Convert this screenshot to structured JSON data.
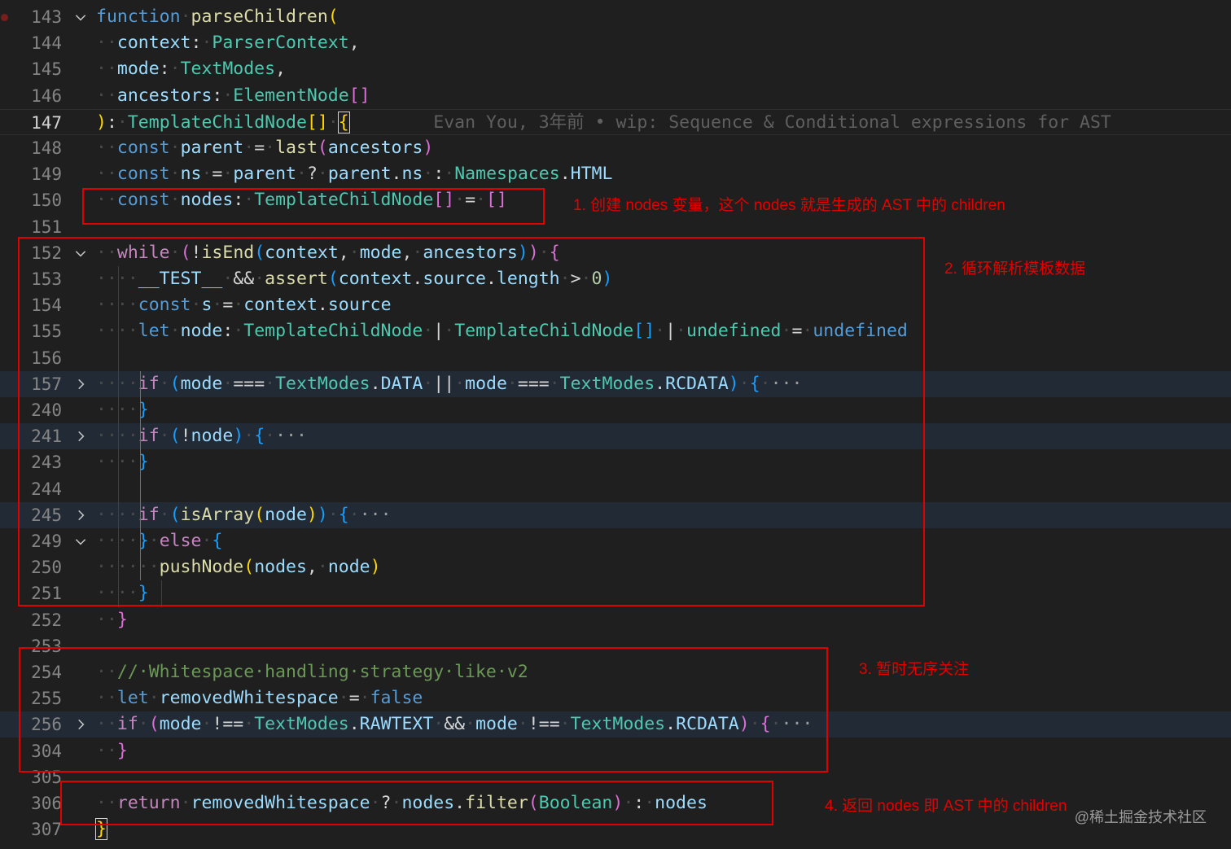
{
  "editor": {
    "breakpoint_line": "143",
    "active_line": "147",
    "lines": [
      {
        "num": "143",
        "fold": "down",
        "tokens": [
          [
            "kw",
            "function"
          ],
          [
            "ws",
            "·"
          ],
          [
            "fn",
            "parseChildren"
          ],
          [
            "br1",
            "("
          ]
        ]
      },
      {
        "num": "144",
        "tokens": [
          [
            "ws",
            "··"
          ],
          [
            "vr",
            "context"
          ],
          [
            "pl",
            ":"
          ],
          [
            "ws",
            "·"
          ],
          [
            "ty",
            "ParserContext"
          ],
          [
            "pl",
            ","
          ]
        ]
      },
      {
        "num": "145",
        "tokens": [
          [
            "ws",
            "··"
          ],
          [
            "vr",
            "mode"
          ],
          [
            "pl",
            ":"
          ],
          [
            "ws",
            "·"
          ],
          [
            "ty",
            "TextModes"
          ],
          [
            "pl",
            ","
          ]
        ]
      },
      {
        "num": "146",
        "tokens": [
          [
            "ws",
            "··"
          ],
          [
            "vr",
            "ancestors"
          ],
          [
            "pl",
            ":"
          ],
          [
            "ws",
            "·"
          ],
          [
            "ty",
            "ElementNode"
          ],
          [
            "br2",
            "[]"
          ]
        ]
      },
      {
        "num": "147",
        "tokens": [
          [
            "br1",
            ")"
          ],
          [
            "pl",
            ":"
          ],
          [
            "ws",
            "·"
          ],
          [
            "ty",
            "TemplateChildNode"
          ],
          [
            "br1",
            "[]"
          ],
          [
            "ws",
            "·"
          ],
          [
            "br1cursor",
            "{"
          ],
          [
            "blame",
            "        Evan You, 3年前 • wip: Sequence & Conditional expressions for AST"
          ]
        ]
      },
      {
        "num": "148",
        "tokens": [
          [
            "ws",
            "··"
          ],
          [
            "kw",
            "const"
          ],
          [
            "ws",
            "·"
          ],
          [
            "vr",
            "parent"
          ],
          [
            "ws",
            "·"
          ],
          [
            "pl",
            "="
          ],
          [
            "ws",
            "·"
          ],
          [
            "fn",
            "last"
          ],
          [
            "br2",
            "("
          ],
          [
            "vr",
            "ancestors"
          ],
          [
            "br2",
            ")"
          ]
        ]
      },
      {
        "num": "149",
        "tokens": [
          [
            "ws",
            "··"
          ],
          [
            "kw",
            "const"
          ],
          [
            "ws",
            "·"
          ],
          [
            "vr",
            "ns"
          ],
          [
            "ws",
            "·"
          ],
          [
            "pl",
            "="
          ],
          [
            "ws",
            "·"
          ],
          [
            "vr",
            "parent"
          ],
          [
            "ws",
            "·"
          ],
          [
            "pl",
            "?"
          ],
          [
            "ws",
            "·"
          ],
          [
            "vr",
            "parent"
          ],
          [
            "pl",
            "."
          ],
          [
            "vr",
            "ns"
          ],
          [
            "ws",
            "·"
          ],
          [
            "pl",
            ":"
          ],
          [
            "ws",
            "·"
          ],
          [
            "ty",
            "Namespaces"
          ],
          [
            "pl",
            "."
          ],
          [
            "vr",
            "HTML"
          ]
        ]
      },
      {
        "num": "150",
        "tokens": [
          [
            "ws",
            "··"
          ],
          [
            "kw",
            "const"
          ],
          [
            "ws",
            "·"
          ],
          [
            "vr",
            "nodes"
          ],
          [
            "pl",
            ":"
          ],
          [
            "ws",
            "·"
          ],
          [
            "ty",
            "TemplateChildNode"
          ],
          [
            "br2",
            "[]"
          ],
          [
            "ws",
            "·"
          ],
          [
            "pl",
            "="
          ],
          [
            "ws",
            "·"
          ],
          [
            "br2",
            "[]"
          ]
        ]
      },
      {
        "num": "151",
        "tokens": []
      },
      {
        "num": "152",
        "fold": "down",
        "tokens": [
          [
            "ws",
            "··"
          ],
          [
            "ctl",
            "while"
          ],
          [
            "ws",
            "·"
          ],
          [
            "br2",
            "("
          ],
          [
            "pl",
            "!"
          ],
          [
            "fn",
            "isEnd"
          ],
          [
            "br3",
            "("
          ],
          [
            "vr",
            "context"
          ],
          [
            "pl",
            ","
          ],
          [
            "ws",
            "·"
          ],
          [
            "vr",
            "mode"
          ],
          [
            "pl",
            ","
          ],
          [
            "ws",
            "·"
          ],
          [
            "vr",
            "ancestors"
          ],
          [
            "br3",
            ")"
          ],
          [
            "br2",
            ")"
          ],
          [
            "ws",
            "·"
          ],
          [
            "br2",
            "{"
          ]
        ]
      },
      {
        "num": "153",
        "tokens": [
          [
            "ws",
            "····"
          ],
          [
            "vr",
            "__TEST__"
          ],
          [
            "ws",
            "·"
          ],
          [
            "pl",
            "&&"
          ],
          [
            "ws",
            "·"
          ],
          [
            "fn",
            "assert"
          ],
          [
            "br3",
            "("
          ],
          [
            "vr",
            "context"
          ],
          [
            "pl",
            "."
          ],
          [
            "vr",
            "source"
          ],
          [
            "pl",
            "."
          ],
          [
            "vr",
            "length"
          ],
          [
            "ws",
            "·"
          ],
          [
            "pl",
            ">"
          ],
          [
            "ws",
            "·"
          ],
          [
            "nm",
            "0"
          ],
          [
            "br3",
            ")"
          ]
        ]
      },
      {
        "num": "154",
        "tokens": [
          [
            "ws",
            "····"
          ],
          [
            "kw",
            "const"
          ],
          [
            "ws",
            "·"
          ],
          [
            "vr",
            "s"
          ],
          [
            "ws",
            "·"
          ],
          [
            "pl",
            "="
          ],
          [
            "ws",
            "·"
          ],
          [
            "vr",
            "context"
          ],
          [
            "pl",
            "."
          ],
          [
            "vr",
            "source"
          ]
        ]
      },
      {
        "num": "155",
        "tokens": [
          [
            "ws",
            "····"
          ],
          [
            "kw",
            "let"
          ],
          [
            "ws",
            "·"
          ],
          [
            "vr",
            "node"
          ],
          [
            "pl",
            ":"
          ],
          [
            "ws",
            "·"
          ],
          [
            "ty",
            "TemplateChildNode"
          ],
          [
            "ws",
            "·"
          ],
          [
            "pl",
            "|"
          ],
          [
            "ws",
            "·"
          ],
          [
            "ty",
            "TemplateChildNode"
          ],
          [
            "br3",
            "[]"
          ],
          [
            "ws",
            "·"
          ],
          [
            "pl",
            "|"
          ],
          [
            "ws",
            "·"
          ],
          [
            "ty",
            "undefined"
          ],
          [
            "ws",
            "·"
          ],
          [
            "pl",
            "="
          ],
          [
            "ws",
            "·"
          ],
          [
            "kw",
            "undefined"
          ]
        ]
      },
      {
        "num": "156",
        "tokens": []
      },
      {
        "num": "157",
        "fold": "right",
        "hl": true,
        "tokens": [
          [
            "ws",
            "····"
          ],
          [
            "ctl",
            "if"
          ],
          [
            "ws",
            "·"
          ],
          [
            "br3",
            "("
          ],
          [
            "vr",
            "mode"
          ],
          [
            "ws",
            "·"
          ],
          [
            "pl",
            "==="
          ],
          [
            "ws",
            "·"
          ],
          [
            "ty",
            "TextModes"
          ],
          [
            "pl",
            "."
          ],
          [
            "vr",
            "DATA"
          ],
          [
            "ws",
            "·"
          ],
          [
            "pl",
            "||"
          ],
          [
            "ws",
            "·"
          ],
          [
            "vr",
            "mode"
          ],
          [
            "ws",
            "·"
          ],
          [
            "pl",
            "==="
          ],
          [
            "ws",
            "·"
          ],
          [
            "ty",
            "TextModes"
          ],
          [
            "pl",
            "."
          ],
          [
            "vr",
            "RCDATA"
          ],
          [
            "br3",
            ")"
          ],
          [
            "ws",
            "·"
          ],
          [
            "br3",
            "{"
          ],
          [
            "ws",
            "·"
          ],
          [
            "ell",
            "···"
          ]
        ]
      },
      {
        "num": "240",
        "tokens": [
          [
            "ws",
            "····"
          ],
          [
            "br3",
            "}"
          ]
        ]
      },
      {
        "num": "241",
        "fold": "right",
        "hl": true,
        "tokens": [
          [
            "ws",
            "····"
          ],
          [
            "ctl",
            "if"
          ],
          [
            "ws",
            "·"
          ],
          [
            "br3",
            "("
          ],
          [
            "pl",
            "!"
          ],
          [
            "vr",
            "node"
          ],
          [
            "br3",
            ")"
          ],
          [
            "ws",
            "·"
          ],
          [
            "br3",
            "{"
          ],
          [
            "ws",
            "·"
          ],
          [
            "ell",
            "···"
          ]
        ]
      },
      {
        "num": "243",
        "tokens": [
          [
            "ws",
            "····"
          ],
          [
            "br3",
            "}"
          ]
        ]
      },
      {
        "num": "244",
        "tokens": []
      },
      {
        "num": "245",
        "fold": "right",
        "hl": true,
        "tokens": [
          [
            "ws",
            "····"
          ],
          [
            "ctl",
            "if"
          ],
          [
            "ws",
            "·"
          ],
          [
            "br3",
            "("
          ],
          [
            "fn",
            "isArray"
          ],
          [
            "br1",
            "("
          ],
          [
            "vr",
            "node"
          ],
          [
            "br1",
            ")"
          ],
          [
            "br3",
            ")"
          ],
          [
            "ws",
            "·"
          ],
          [
            "br3",
            "{"
          ],
          [
            "ws",
            "·"
          ],
          [
            "ell",
            "···"
          ]
        ]
      },
      {
        "num": "249",
        "fold": "down",
        "tokens": [
          [
            "ws",
            "····"
          ],
          [
            "br3",
            "}"
          ],
          [
            "ws",
            "·"
          ],
          [
            "ctl",
            "else"
          ],
          [
            "ws",
            "·"
          ],
          [
            "br3",
            "{"
          ]
        ]
      },
      {
        "num": "250",
        "tokens": [
          [
            "ws",
            "······"
          ],
          [
            "fn",
            "pushNode"
          ],
          [
            "br1",
            "("
          ],
          [
            "vr",
            "nodes"
          ],
          [
            "pl",
            ","
          ],
          [
            "ws",
            "·"
          ],
          [
            "vr",
            "node"
          ],
          [
            "br1",
            ")"
          ]
        ]
      },
      {
        "num": "251",
        "tokens": [
          [
            "ws",
            "····"
          ],
          [
            "br3",
            "}"
          ]
        ]
      },
      {
        "num": "252",
        "tokens": [
          [
            "ws",
            "··"
          ],
          [
            "br2",
            "}"
          ]
        ]
      },
      {
        "num": "253",
        "tokens": []
      },
      {
        "num": "254",
        "tokens": [
          [
            "ws",
            "··"
          ],
          [
            "cm",
            "//·Whitespace·handling·strategy·like·v2"
          ]
        ]
      },
      {
        "num": "255",
        "tokens": [
          [
            "ws",
            "··"
          ],
          [
            "kw",
            "let"
          ],
          [
            "ws",
            "·"
          ],
          [
            "vr",
            "removedWhitespace"
          ],
          [
            "ws",
            "·"
          ],
          [
            "pl",
            "="
          ],
          [
            "ws",
            "·"
          ],
          [
            "kw",
            "false"
          ]
        ]
      },
      {
        "num": "256",
        "fold": "right",
        "hl": true,
        "tokens": [
          [
            "ws",
            "··"
          ],
          [
            "ctl",
            "if"
          ],
          [
            "ws",
            "·"
          ],
          [
            "br2",
            "("
          ],
          [
            "vr",
            "mode"
          ],
          [
            "ws",
            "·"
          ],
          [
            "pl",
            "!=="
          ],
          [
            "ws",
            "·"
          ],
          [
            "ty",
            "TextModes"
          ],
          [
            "pl",
            "."
          ],
          [
            "vr",
            "RAWTEXT"
          ],
          [
            "ws",
            "·"
          ],
          [
            "pl",
            "&&"
          ],
          [
            "ws",
            "·"
          ],
          [
            "vr",
            "mode"
          ],
          [
            "ws",
            "·"
          ],
          [
            "pl",
            "!=="
          ],
          [
            "ws",
            "·"
          ],
          [
            "ty",
            "TextModes"
          ],
          [
            "pl",
            "."
          ],
          [
            "vr",
            "RCDATA"
          ],
          [
            "br2",
            ")"
          ],
          [
            "ws",
            "·"
          ],
          [
            "br2",
            "{"
          ],
          [
            "ws",
            "·"
          ],
          [
            "ell",
            "···"
          ]
        ]
      },
      {
        "num": "304",
        "tokens": [
          [
            "ws",
            "··"
          ],
          [
            "br2",
            "}"
          ]
        ]
      },
      {
        "num": "305",
        "tokens": []
      },
      {
        "num": "306",
        "tokens": [
          [
            "ws",
            "··"
          ],
          [
            "ctl",
            "return"
          ],
          [
            "ws",
            "·"
          ],
          [
            "vr",
            "removedWhitespace"
          ],
          [
            "ws",
            "·"
          ],
          [
            "pl",
            "?"
          ],
          [
            "ws",
            "·"
          ],
          [
            "vr",
            "nodes"
          ],
          [
            "pl",
            "."
          ],
          [
            "fn",
            "filter"
          ],
          [
            "br2",
            "("
          ],
          [
            "ty",
            "Boolean"
          ],
          [
            "br2",
            ")"
          ],
          [
            "ws",
            "·"
          ],
          [
            "pl",
            ":"
          ],
          [
            "ws",
            "·"
          ],
          [
            "vr",
            "nodes"
          ]
        ]
      },
      {
        "num": "307",
        "tokens": [
          [
            "br1cursor",
            "}"
          ]
        ]
      }
    ]
  },
  "annotations": {
    "a1": "1. 创建 nodes 变量，这个 nodes 就是生成的 AST 中的 children",
    "a2": "2. 循环解析模板数据",
    "a3": "3. 暂时无序关注",
    "a4": "4. 返回 nodes 即  AST 中的 children"
  },
  "watermark": "@稀土掘金技术社区",
  "colors": {
    "background": "#1f1f1f",
    "keyword": "#569cd6",
    "function": "#dcdcaa",
    "type": "#4ec9b0",
    "variable": "#9cdcfe",
    "comment": "#6a9955",
    "annotation": "#e00000"
  }
}
